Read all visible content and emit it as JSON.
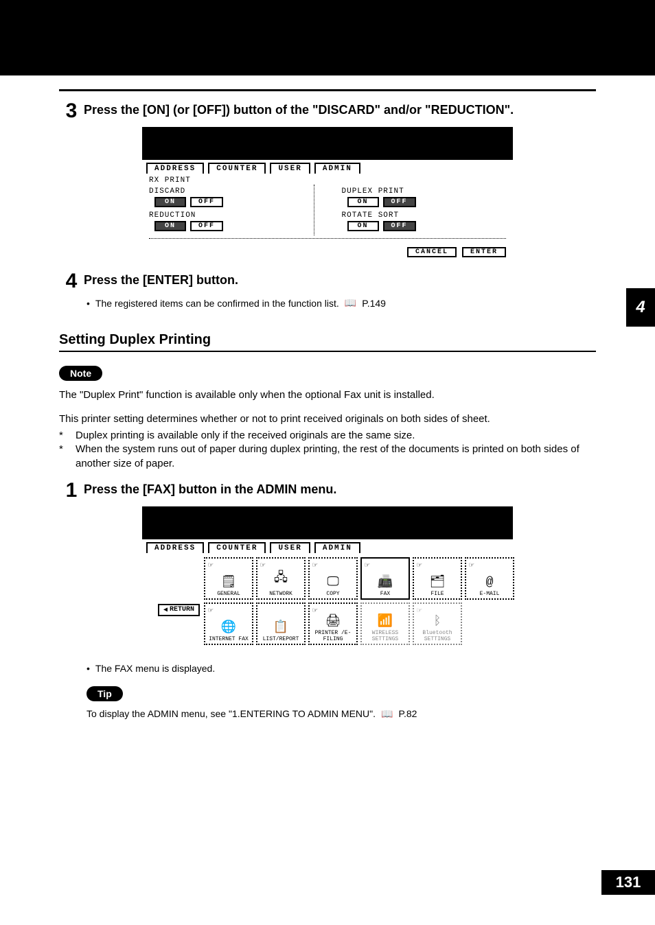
{
  "page": {
    "number": "131",
    "chapter_tab": "4"
  },
  "steps": {
    "s3": {
      "num": "3",
      "text": "Press the [ON] (or [OFF]) button of the \"DISCARD\" and/or \"REDUCTION\"."
    },
    "s4": {
      "num": "4",
      "text": "Press the [ENTER] button.",
      "bullet": "The registered items can be confirmed in the function list.",
      "ref": "P.149"
    },
    "s1": {
      "num": "1",
      "text": "Press the [FAX] button in the ADMIN menu.",
      "bullet": "The FAX menu is displayed."
    }
  },
  "heading": {
    "duplex": "Setting Duplex Printing"
  },
  "labels": {
    "note": "Note",
    "tip": "Tip"
  },
  "body": {
    "note_text": "The \"Duplex Print\" function is available only when the optional Fax unit is installed.",
    "intro": "This printer setting determines whether or not to print received originals on both sides of sheet.",
    "star1": "Duplex printing is available only if the received originals are the same size.",
    "star2": "When the system runs out of paper during duplex printing, the rest of the documents is printed on both sides of another size of paper.",
    "tip_text": "To display the ADMIN menu, see \"1.ENTERING TO ADMIN MENU\".",
    "tip_ref": "P.82"
  },
  "screen1": {
    "tabs": [
      "ADDRESS",
      "COUNTER",
      "USER",
      "ADMIN"
    ],
    "header": "RX PRINT",
    "left": {
      "discard": "DISCARD",
      "reduction": "REDUCTION"
    },
    "right": {
      "duplex": "DUPLEX PRINT",
      "rotate": "ROTATE SORT"
    },
    "on": "ON",
    "off": "OFF",
    "cancel": "CANCEL",
    "enter": "ENTER"
  },
  "screen2": {
    "tabs": [
      "ADDRESS",
      "COUNTER",
      "USER",
      "ADMIN"
    ],
    "return": "RETURN",
    "cells": {
      "general": "GENERAL",
      "network": "NETWORK",
      "copy": "COPY",
      "fax": "FAX",
      "file": "FILE",
      "email": "E-MAIL",
      "ifax": "INTERNET FAX",
      "list": "LIST/REPORT",
      "printer": "PRINTER /E-FILING",
      "wireless": "WIRELESS SETTINGS",
      "bluetooth": "Bluetooth SETTINGS"
    }
  }
}
